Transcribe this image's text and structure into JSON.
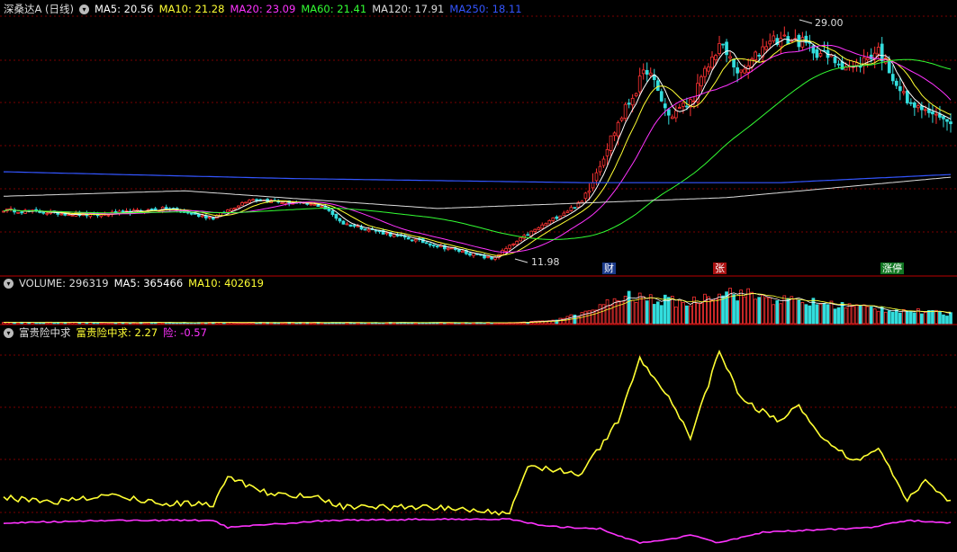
{
  "header": {
    "title": "深桑达A (日线)",
    "ma": [
      {
        "label": "MA5: 20.56",
        "color": "#ffffff"
      },
      {
        "label": "MA10: 21.28",
        "color": "#ffff33"
      },
      {
        "label": "MA20: 23.09",
        "color": "#ff33ff"
      },
      {
        "label": "MA60: 21.41",
        "color": "#33ff33"
      },
      {
        "label": "MA120: 17.91",
        "color": "#dddddd"
      },
      {
        "label": "MA250: 18.11",
        "color": "#3355ff"
      }
    ]
  },
  "volume_header": {
    "label": "VOLUME: 296319",
    "ma5": "MA5: 365466",
    "ma10": "MA10: 402619"
  },
  "indicator_header": {
    "name": "富贵险中求",
    "line1": "富贵险中求: 2.27",
    "line2": "险: -0.57"
  },
  "annotations": {
    "high": "29.00",
    "low": "11.98",
    "markers": [
      "财",
      "张",
      "涨停"
    ]
  },
  "colors": {
    "up": "#ff3333",
    "down": "#33dddd",
    "grid": "#7a0000",
    "ma5": "#ffffff",
    "ma10": "#ffff33",
    "ma20": "#ff33ff",
    "ma60": "#33ff33",
    "ma120": "#dddddd",
    "ma250": "#3355ff",
    "ind1": "#ffff33",
    "ind2": "#ff33ff"
  },
  "chart_data": {
    "type": "candlestick",
    "price_range": [
      11.0,
      30.5
    ],
    "close_anchors": [
      [
        0,
        15.6
      ],
      [
        25,
        15.2
      ],
      [
        45,
        15.7
      ],
      [
        58,
        15.0
      ],
      [
        68,
        16.4
      ],
      [
        88,
        15.9
      ],
      [
        94,
        14.6
      ],
      [
        115,
        13.3
      ],
      [
        135,
        12.0
      ],
      [
        145,
        13.8
      ],
      [
        160,
        16.2
      ],
      [
        170,
        22.0
      ],
      [
        178,
        26.0
      ],
      [
        184,
        22.5
      ],
      [
        190,
        23.5
      ],
      [
        198,
        27.8
      ],
      [
        204,
        25.5
      ],
      [
        212,
        28.2
      ],
      [
        220,
        28.0
      ],
      [
        228,
        26.8
      ],
      [
        235,
        26.0
      ],
      [
        242,
        27.4
      ],
      [
        250,
        23.5
      ],
      [
        255,
        22.9
      ],
      [
        262,
        22.0
      ]
    ],
    "ma250_anchors": [
      [
        0,
        18.4
      ],
      [
        80,
        17.9
      ],
      [
        160,
        17.6
      ],
      [
        215,
        17.6
      ],
      [
        262,
        18.2
      ]
    ],
    "ma120_anchors": [
      [
        0,
        16.6
      ],
      [
        50,
        17.0
      ],
      [
        120,
        15.7
      ],
      [
        160,
        16.1
      ],
      [
        200,
        16.5
      ],
      [
        262,
        18.0
      ]
    ],
    "volume_range": [
      0,
      1000000
    ],
    "volume_anchors": [
      [
        0,
        40000
      ],
      [
        140,
        30000
      ],
      [
        150,
        80000
      ],
      [
        160,
        300000
      ],
      [
        172,
        850000
      ],
      [
        190,
        650000
      ],
      [
        198,
        1050000
      ],
      [
        215,
        750000
      ],
      [
        240,
        500000
      ],
      [
        262,
        300000
      ]
    ],
    "indicator_range": [
      -1.6,
      15.6
    ],
    "ind1_anchors": [
      [
        0,
        2.5
      ],
      [
        15,
        2.2
      ],
      [
        30,
        2.7
      ],
      [
        45,
        2.0
      ],
      [
        58,
        2.0
      ],
      [
        62,
        4.3
      ],
      [
        72,
        3.0
      ],
      [
        88,
        2.4
      ],
      [
        94,
        1.7
      ],
      [
        118,
        1.7
      ],
      [
        140,
        1.2
      ],
      [
        145,
        5.2
      ],
      [
        160,
        4.5
      ],
      [
        170,
        9.0
      ],
      [
        176,
        14.2
      ],
      [
        184,
        11.0
      ],
      [
        190,
        7.5
      ],
      [
        198,
        14.8
      ],
      [
        204,
        10.8
      ],
      [
        214,
        9.0
      ],
      [
        220,
        10.2
      ],
      [
        228,
        7.0
      ],
      [
        236,
        5.5
      ],
      [
        242,
        6.5
      ],
      [
        250,
        2.3
      ],
      [
        255,
        3.8
      ],
      [
        262,
        2.27
      ]
    ],
    "ind2_anchors": [
      [
        0,
        0.4
      ],
      [
        30,
        0.6
      ],
      [
        58,
        0.6
      ],
      [
        62,
        0.0
      ],
      [
        90,
        0.6
      ],
      [
        120,
        0.7
      ],
      [
        140,
        0.7
      ],
      [
        150,
        0.1
      ],
      [
        165,
        -0.1
      ],
      [
        176,
        -1.3
      ],
      [
        184,
        -1.0
      ],
      [
        190,
        -0.6
      ],
      [
        198,
        -1.3
      ],
      [
        210,
        -0.4
      ],
      [
        240,
        0.0
      ],
      [
        250,
        0.6
      ],
      [
        262,
        0.4
      ]
    ]
  }
}
